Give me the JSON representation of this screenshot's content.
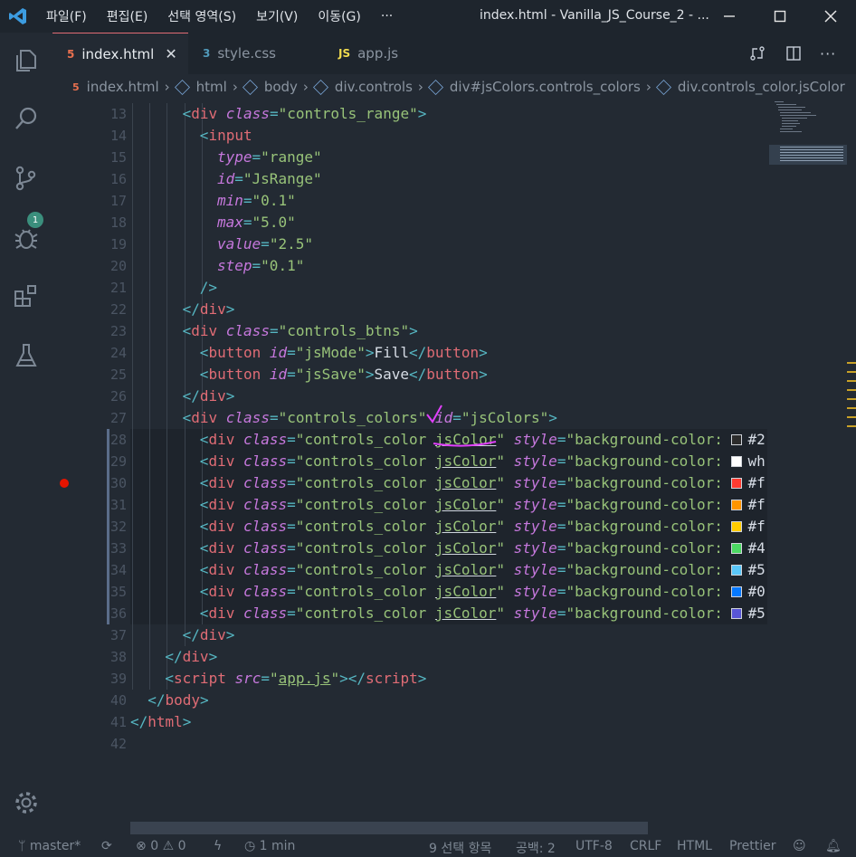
{
  "titlebar": {
    "menu": [
      "파일(F)",
      "편집(E)",
      "선택 영역(S)",
      "보기(V)",
      "이동(G)",
      "···"
    ],
    "title": "index.html - Vanilla_JS_Course_2 - ..."
  },
  "tabs": [
    {
      "icon": "5",
      "label": "index.html",
      "active": true,
      "close": "✕"
    },
    {
      "icon": "3",
      "label": "style.css",
      "active": false
    },
    {
      "icon": "JS",
      "label": "app.js",
      "active": false
    }
  ],
  "breadcrumb": [
    "index.html",
    "html",
    "body",
    "div.controls",
    "div#jsColors.controls_colors",
    "div.controls_color.jsColor"
  ],
  "scm_badge": "1",
  "code": {
    "line_numbers": [
      "13",
      "14",
      "15",
      "16",
      "17",
      "18",
      "19",
      "20",
      "21",
      "22",
      "23",
      "24",
      "25",
      "26",
      "27",
      "28",
      "29",
      "30",
      "31",
      "32",
      "33",
      "34",
      "35",
      "36",
      "37",
      "38",
      "39",
      "40",
      "41",
      "42"
    ],
    "breakpoint_line": "30",
    "style_prefix": "\"background-color: ",
    "swatches": [
      {
        "color": "#2c2c2c",
        "text": "#2"
      },
      {
        "color": "#ffffff",
        "text": "wh"
      },
      {
        "color": "#ff3b30",
        "text": "#f"
      },
      {
        "color": "#ff9500",
        "text": "#f"
      },
      {
        "color": "#ffcc00",
        "text": "#f"
      },
      {
        "color": "#4cd963",
        "text": "#4"
      },
      {
        "color": "#5ac8fa",
        "text": "#5"
      },
      {
        "color": "#0579ff",
        "text": "#0"
      },
      {
        "color": "#5856d6",
        "text": "#5"
      }
    ]
  },
  "statusbar": {
    "branch": "master*",
    "errors": "0",
    "warnings": "0",
    "time": "1 min",
    "selection": "9 선택 항목",
    "spaces": "공백: 2",
    "encoding": "UTF-8",
    "eol": "CRLF",
    "language": "HTML",
    "formatter": "Prettier"
  }
}
